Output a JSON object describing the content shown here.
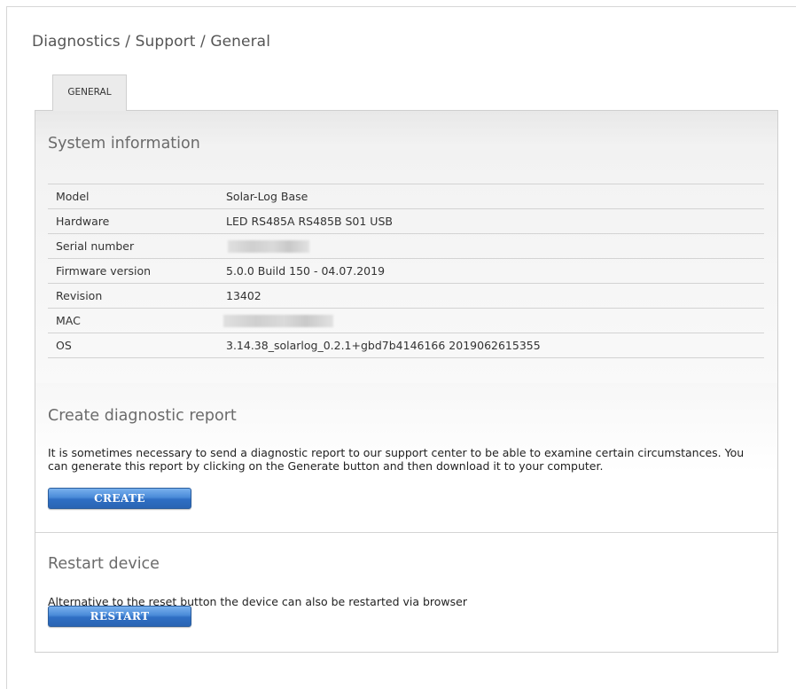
{
  "breadcrumb": "Diagnostics / Support / General",
  "tabs": [
    {
      "label": "GENERAL",
      "active": true
    }
  ],
  "system_info": {
    "title": "System information",
    "rows": [
      {
        "key": "Model",
        "value": "Solar-Log Base"
      },
      {
        "key": "Hardware",
        "value": "LED RS485A RS485B S01 USB"
      },
      {
        "key": "Serial number",
        "value": "",
        "redacted": true
      },
      {
        "key": "Firmware version",
        "value": "5.0.0 Build 150 - 04.07.2019"
      },
      {
        "key": "Revision",
        "value": "13402"
      },
      {
        "key": "MAC",
        "value": "",
        "redacted": true
      },
      {
        "key": "OS",
        "value": "3.14.38_solarlog_0.2.1+gbd7b4146166 2019062615355"
      }
    ]
  },
  "diagnostic_report": {
    "title": "Create diagnostic report",
    "description": "It is sometimes necessary to send a diagnostic report to our support center to be able to examine certain circumstances. You can generate this report by clicking on the Generate button and then download it to your computer.",
    "button_label": "CREATE"
  },
  "restart": {
    "title": "Restart device",
    "description": "Alternative to the reset button the device can also be restarted via browser",
    "button_label": "RESTART"
  },
  "colors": {
    "button_blue": "#3b7bd0",
    "section_title": "#6b6b6b",
    "border": "#cfcfcf"
  }
}
